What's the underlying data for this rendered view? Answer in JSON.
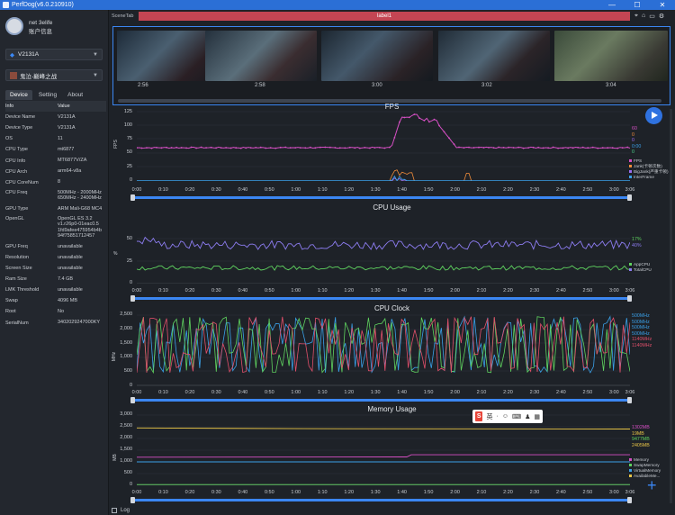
{
  "window": {
    "title": "PerfDog(v6.0.210910)",
    "controls": [
      "—",
      "☐",
      "✕"
    ]
  },
  "user": {
    "name": "net 3elife",
    "account_label": "账户信息"
  },
  "device_select": {
    "value": "V2131A"
  },
  "app_select": {
    "value": "鬼泣-巅峰之战"
  },
  "tabs": [
    "Device",
    "Setting",
    "About"
  ],
  "device_info": {
    "header": {
      "key": "Info",
      "value": "Value"
    },
    "rows": [
      {
        "k": "Device Name",
        "v": "V2131A"
      },
      {
        "k": "Device Type",
        "v": "V2131A"
      },
      {
        "k": "OS",
        "v": "11"
      },
      {
        "k": "CPU Type",
        "v": "mt6877"
      },
      {
        "k": "CPU Info",
        "v": "MT6877V/ZA"
      },
      {
        "k": "CPU Arch",
        "v": "arm64-v8a"
      },
      {
        "k": "CPU CoreNum",
        "v": "8"
      },
      {
        "k": "CPU Freq",
        "v": "500MHz - 2000MHz 650MHz - 2400MHz"
      },
      {
        "k": "GPU Type",
        "v": "ARM Mali-G68 MC4"
      },
      {
        "k": "OpenGL",
        "v": "OpenGL ES 3.2 v1.r26p0-01eac0.5 1fd9afee475954b4b 94f75851712457"
      },
      {
        "k": "GPU Freq",
        "v": "unavailable"
      },
      {
        "k": "Resolution",
        "v": "unavailable"
      },
      {
        "k": "Screen Size",
        "v": "unavailable"
      },
      {
        "k": "Ram Size",
        "v": "7.4 GB"
      },
      {
        "k": "LMK Threshold",
        "v": "unavailable"
      },
      {
        "k": "Swap",
        "v": "4096 MB"
      },
      {
        "k": "Root",
        "v": "No"
      },
      {
        "k": "SerialNum",
        "v": "3402029247000KY"
      }
    ]
  },
  "scene": {
    "tab_label": "SceneTab",
    "label": "label1"
  },
  "thumbnails": {
    "times": [
      "2:56",
      "2:58",
      "3:00",
      "3:02",
      "3:04"
    ]
  },
  "x_ticks": [
    "0:00",
    "0:10",
    "0:20",
    "0:30",
    "0:40",
    "0:50",
    "1:00",
    "1:10",
    "1:20",
    "1:30",
    "1:40",
    "1:50",
    "2:00",
    "2:10",
    "2:20",
    "2:30",
    "2:40",
    "2:50",
    "3:00",
    "3:06"
  ],
  "charts": {
    "fps": {
      "title": "FPS",
      "y_ticks": [
        "125",
        "100",
        "75",
        "50",
        "25",
        "0"
      ],
      "ylabel": "FPS",
      "values": [
        "60",
        "0",
        "0",
        "0:00",
        "0"
      ],
      "value_colors": [
        "#d64fc4",
        "#f08c3a",
        "#9b6cf0",
        "#3aa0e8",
        "#4bd08c"
      ],
      "legend": [
        {
          "name": "FPS",
          "color": "#d64fc4"
        },
        {
          "name": "Jank(卡顿次数)",
          "color": "#f08c3a"
        },
        {
          "name": "BigJank(严重卡顿)",
          "color": "#9b6cf0"
        },
        {
          "name": "InterFrame",
          "color": "#3aa0e8"
        }
      ]
    },
    "cpu": {
      "title": "CPU Usage",
      "y_ticks": [
        "50",
        "25",
        "0"
      ],
      "ylabel": "%",
      "values": [
        "17%",
        "40%"
      ],
      "value_colors": [
        "#5fd35f",
        "#8c7cf0"
      ],
      "legend": [
        {
          "name": "AppCPU",
          "color": "#5fd35f"
        },
        {
          "name": "TotalCPU",
          "color": "#8c7cf0"
        }
      ]
    },
    "clock": {
      "title": "CPU Clock",
      "y_ticks": [
        "2,500",
        "2,000",
        "1,500",
        "1,000",
        "500",
        "0"
      ],
      "ylabel": "MHz",
      "values": [
        "500MHz",
        "500MHz",
        "500MHz",
        "500MHz",
        "1140MHz",
        "1140MHz"
      ],
      "value_colors": [
        "#3aa0e8",
        "#3aa0e8",
        "#3aa0e8",
        "#3aa0e8",
        "#e04f6a",
        "#e04f6a"
      ]
    },
    "memory": {
      "title": "Memory Usage",
      "y_ticks": [
        "3,000",
        "2,500",
        "2,000",
        "1,500",
        "1,000",
        "500",
        "0"
      ],
      "ylabel": "MB",
      "values": [
        "1302MB",
        "19MB",
        "9477MB",
        "2405MB"
      ],
      "value_colors": [
        "#d64fc4",
        "#e8c547",
        "#5fd35f",
        "#e8c547"
      ],
      "legend": [
        {
          "name": "Memory",
          "color": "#d64fc4"
        },
        {
          "name": "SwapMemory",
          "color": "#5fd35f"
        },
        {
          "name": "VirtualMemory",
          "color": "#3aa0e8"
        },
        {
          "name": "AvailableMe...",
          "color": "#e8c547"
        }
      ]
    }
  },
  "ime": {
    "label": "英"
  },
  "bottom": {
    "log_label": "Log"
  },
  "chart_data": [
    {
      "type": "line",
      "title": "FPS",
      "ylim": [
        0,
        125
      ],
      "x": [
        "0:00",
        "1:00",
        "1:30",
        "1:38",
        "1:42",
        "1:45",
        "1:52",
        "2:00",
        "2:30",
        "3:06"
      ],
      "series": [
        {
          "name": "FPS",
          "values": [
            60,
            60,
            60,
            75,
            120,
            112,
            100,
            62,
            60,
            60
          ]
        }
      ]
    },
    {
      "type": "line",
      "title": "CPU Usage",
      "ylim": [
        0,
        60
      ],
      "series": [
        {
          "name": "AppCPU",
          "values": [
            17,
            18,
            17,
            18,
            16,
            17,
            17,
            18,
            17,
            17
          ]
        },
        {
          "name": "TotalCPU",
          "values": [
            45,
            40,
            38,
            44,
            42,
            40,
            41,
            42,
            40,
            40
          ]
        }
      ]
    },
    {
      "type": "line",
      "title": "CPU Clock",
      "ylim": [
        0,
        2500
      ]
    },
    {
      "type": "line",
      "title": "Memory Usage",
      "ylim": [
        0,
        3000
      ],
      "series": [
        {
          "name": "Memory",
          "values": [
            1302,
            1302,
            1302,
            1302,
            1302
          ]
        },
        {
          "name": "SwapMemory",
          "values": [
            19,
            19,
            19,
            19,
            19
          ]
        },
        {
          "name": "VirtualMemory",
          "values": [
            1000,
            1000,
            1000,
            1000,
            1000
          ]
        },
        {
          "name": "AvailableMe...",
          "values": [
            2405,
            2405,
            2405,
            2405,
            2405
          ]
        }
      ]
    }
  ]
}
